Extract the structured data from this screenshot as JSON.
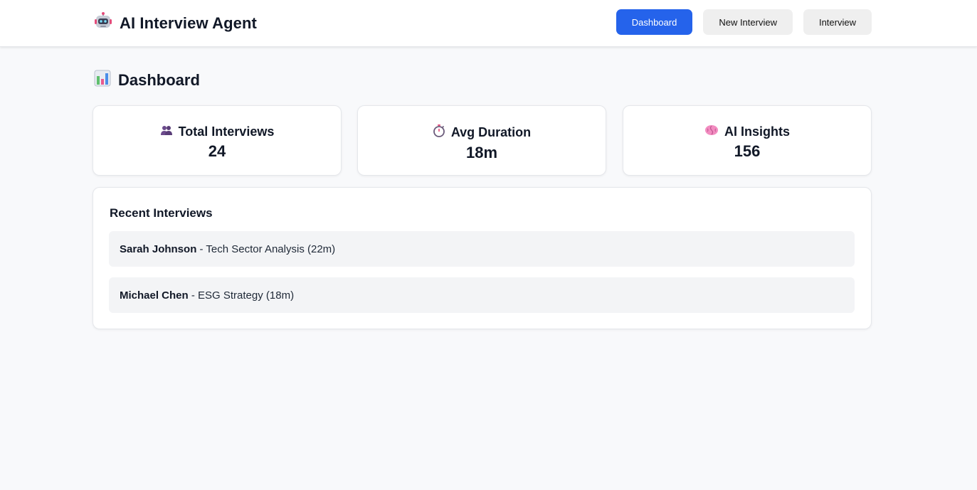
{
  "header": {
    "title": "AI Interview Agent",
    "logo_icon": "robot-icon",
    "nav": [
      {
        "label": "Dashboard",
        "active": true
      },
      {
        "label": "New Interview",
        "active": false
      },
      {
        "label": "Interview",
        "active": false
      }
    ]
  },
  "page": {
    "title": "Dashboard",
    "icon": "bar-chart-icon"
  },
  "stats": [
    {
      "label": "Total Interviews",
      "value": "24",
      "icon": "people-icon"
    },
    {
      "label": "Avg Duration",
      "value": "18m",
      "icon": "stopwatch-icon"
    },
    {
      "label": "AI Insights",
      "value": "156",
      "icon": "brain-icon"
    }
  ],
  "recent": {
    "title": "Recent Interviews",
    "items": [
      {
        "name": "Sarah Johnson",
        "detail": " - Tech Sector Analysis (22m)"
      },
      {
        "name": "Michael Chen",
        "detail": " - ESG Strategy (18m)"
      }
    ]
  },
  "colors": {
    "accent": "#2563eb",
    "background": "#f8f9fb",
    "card": "#ffffff",
    "row": "#f3f4f6"
  }
}
